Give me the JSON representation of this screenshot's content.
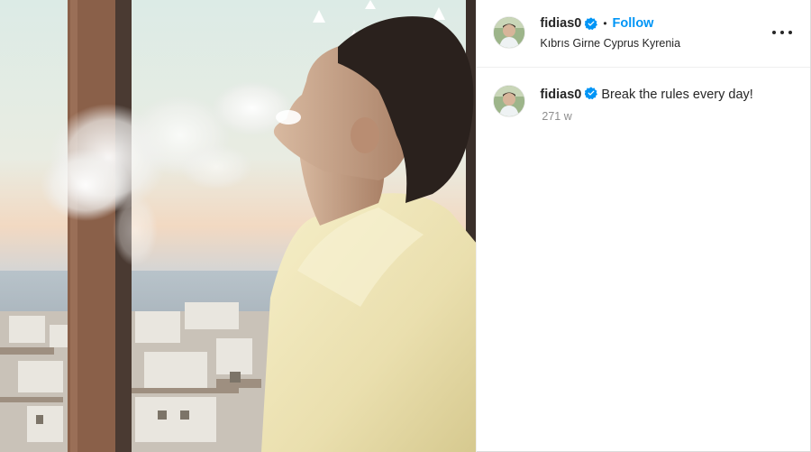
{
  "post": {
    "author": {
      "username": "fidias0",
      "verified": true,
      "avatar_icon": "avatar-photo"
    },
    "follow_label": "Follow",
    "separator": "•",
    "location": "Kıbrıs Girne Cyprus Kyrenia",
    "more_icon": "more-horizontal-icon",
    "photo_description_icon": "post-photo",
    "caption": {
      "username": "fidias0",
      "text": "Break the rules every day!",
      "age": "271 w"
    },
    "colors": {
      "accent": "#0095f6",
      "verified": "#0095f6",
      "text": "#262626",
      "muted": "#8e8e8e",
      "divider": "#efefef"
    }
  }
}
